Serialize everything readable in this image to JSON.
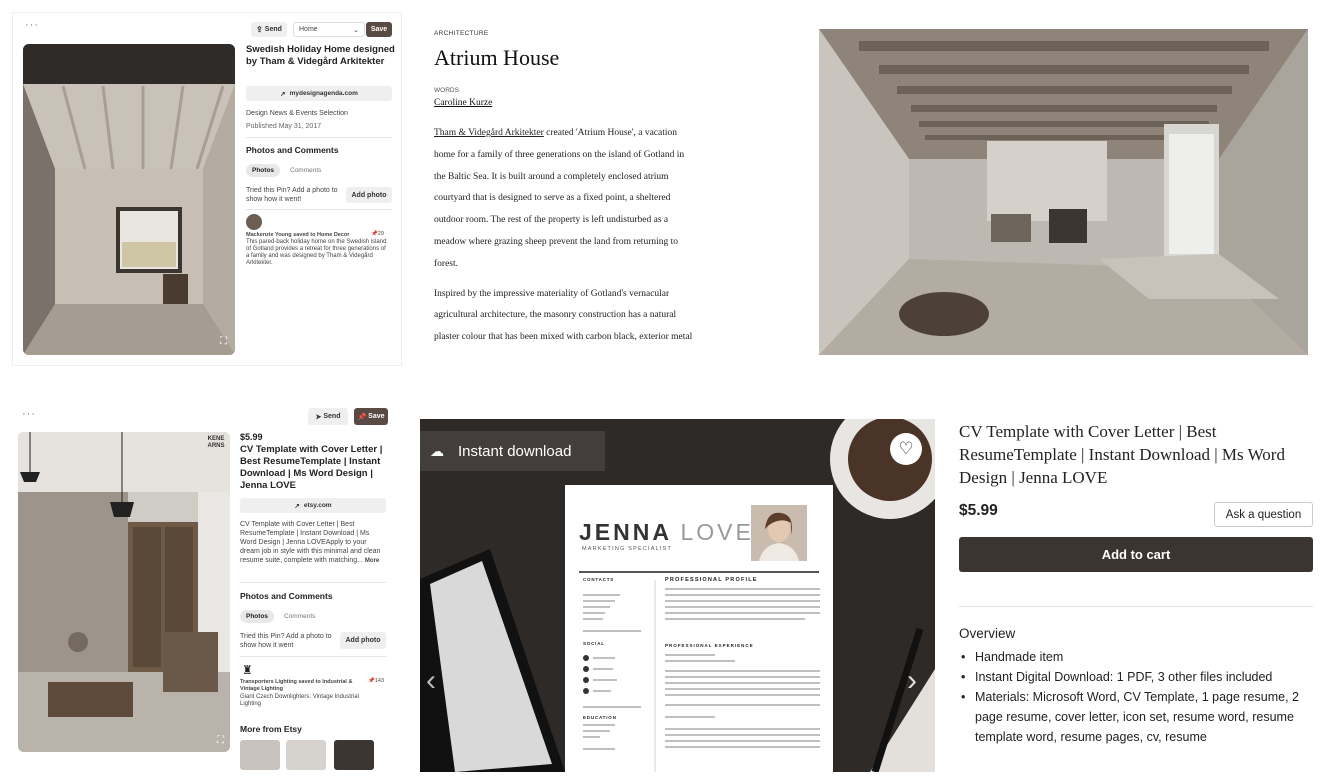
{
  "pin1": {
    "menu": "···",
    "send_label": "Send",
    "board_select": "Home",
    "save_label": "Save",
    "title": "Swedish Holiday Home designed by Tham & Videgård Arkitekter",
    "link": "mydesignagenda.com",
    "source": "Design News & Events Selection",
    "published": "Published May 31, 2017",
    "photos_comments": "Photos and Comments",
    "tab_photos": "Photos",
    "tab_comments": "Comments",
    "tried_text": "Tried this Pin? Add a photo to show how it went!",
    "add_photo": "Add photo",
    "saver": "Mackenzie Young saved to Home Decor",
    "save_count": "29",
    "saver_desc": "This pared-back holiday home on the Swedish island of Gotland provides a retreat for three generations of a family and was designed by Tham & Videgård Arkitekter."
  },
  "article": {
    "category": "ARCHITECTURE",
    "title": "Atrium House",
    "words_label": "WORDS",
    "author": "Caroline Kurze",
    "para1_link": "Tham & Videgård Arkitekter",
    "para1_lines": [
      " created 'Atrium House', a vacation",
      "home for a family of three generations on the island of Gotland in",
      "the Baltic Sea. It is built around a completely enclosed atrium",
      "courtyard that is designed to serve as a fixed point, a sheltered",
      "outdoor room. The rest of the property is left undisturbed as a",
      "meadow where grazing sheep prevent the land from returning to",
      "forest."
    ],
    "para2_lines": [
      "Inspired by the impressive materiality of Gotland's vernacular",
      "agricultural architecture, the masonry construction has a natural",
      "plaster colour that has been mixed with carbon black, exterior metal"
    ]
  },
  "pin2": {
    "menu": "···",
    "send_label": "Send",
    "save_label": "Save",
    "price": "$5.99",
    "title": "CV Template with Cover Letter | Best ResumeTemplate | Instant Download | Ms Word Design | Jenna LOVE",
    "link": "etsy.com",
    "desc": "CV Template with Cover Letter | Best ResumeTemplate | Instant Download | Ms Word Design | Jenna LOVEApply to your dream job in style with this minimal and clean resume suite, complete with matching...",
    "more": "More",
    "photos_comments": "Photos and Comments",
    "tab_photos": "Photos",
    "tab_comments": "Comments",
    "tried_text": "Tried this Pin? Add a photo to show how it went",
    "add_photo": "Add photo",
    "saver": "Transporters Lighting saved to Industrial & Vintage Lighting",
    "save_count": "143",
    "saver_desc": "Giant Czech Downlighters. Vintage Industrial Lighting",
    "more_from": "More from Etsy",
    "image_brand": "KENE ARNS"
  },
  "cv_image": {
    "badge": "Instant download",
    "first_name": "JENNA",
    "last_name": "LOVE",
    "role": "MARKETING SPECIALIST",
    "contacts": "CONTACTS",
    "profile": "PROFESSIONAL PROFILE",
    "experience": "PROFESSIONAL EXPERIENCE",
    "social": "SOCIAL",
    "education": "EDUCATION"
  },
  "etsy": {
    "title": "CV Template with Cover Letter | Best ResumeTemplate | Instant Download | Ms Word Design | Jenna LOVE",
    "price": "$5.99",
    "ask": "Ask a question",
    "add_to_cart": "Add to cart",
    "overview": "Overview",
    "items": [
      "Handmade item",
      "Instant Digital Download: 1 PDF, 3 other files included",
      "Materials: Microsoft Word, CV Template, 1 page resume, 2 page resume, cover letter, icon set, resume word, resume template word, resume pages, cv, resume"
    ]
  },
  "colors": {
    "save_brown": "#5a4a44",
    "cart_dark": "#3b3431"
  }
}
